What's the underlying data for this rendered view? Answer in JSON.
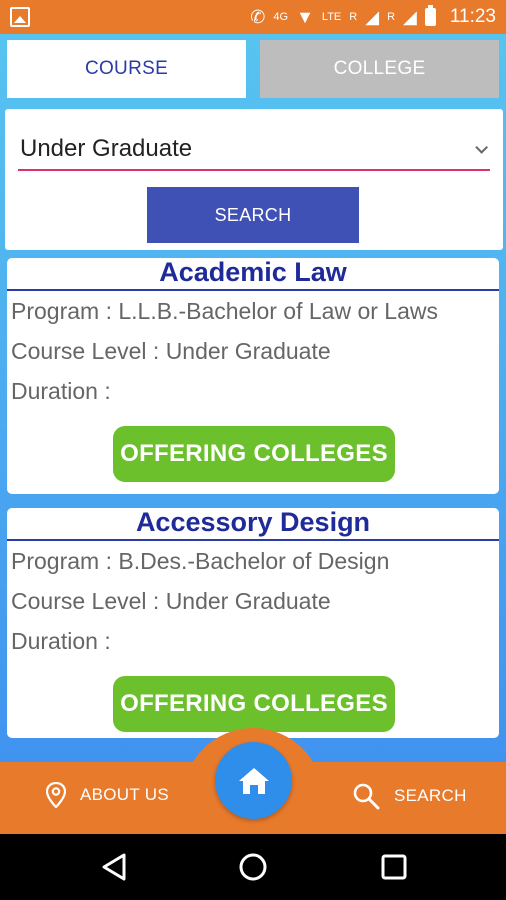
{
  "status_bar": {
    "network_label": "LTE",
    "roaming_1": "R",
    "roaming_2": "R",
    "lte_small": "4G",
    "time": "11:23"
  },
  "tabs": {
    "course": "COURSE",
    "college": "COLLEGE"
  },
  "search": {
    "select_value": "Under Graduate",
    "button_label": "SEARCH"
  },
  "courses": [
    {
      "title": "Academic Law",
      "program": "Program : L.L.B.-Bachelor of Law or Laws",
      "level": "Course Level : Under Graduate",
      "duration": "Duration :",
      "button": "OFFERING COLLEGES"
    },
    {
      "title": "Accessory Design",
      "program": "Program : B.Des.-Bachelor of Design",
      "level": "Course Level : Under Graduate",
      "duration": "Duration :",
      "button": "OFFERING COLLEGES"
    }
  ],
  "bottom_nav": {
    "about": "ABOUT US",
    "search": "SEARCH"
  },
  "colors": {
    "primary_orange": "#E87A2C",
    "tab_active_text": "#2A3BA8",
    "search_button": "#3F51B5",
    "offer_button": "#6BC02C",
    "home_fab": "#2F8EEA"
  },
  "icons": {
    "status_left": "image-icon",
    "home": "home-icon",
    "about": "location-pin-icon",
    "search": "search-icon"
  }
}
